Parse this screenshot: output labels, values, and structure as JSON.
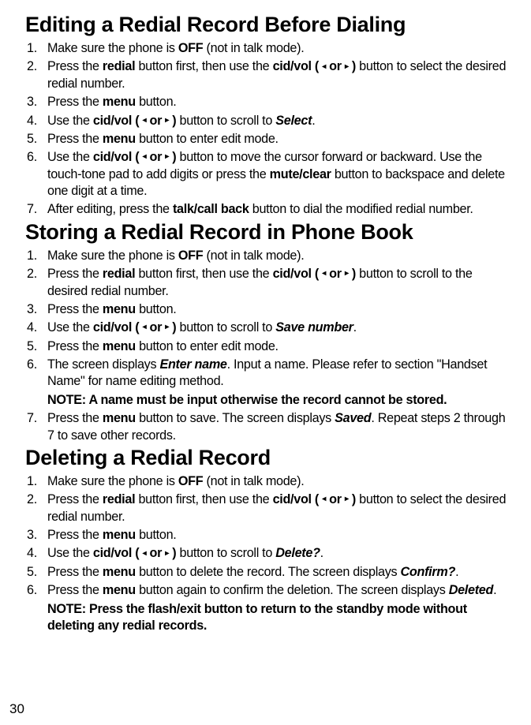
{
  "section1": {
    "heading": "Editing a Redial Record Before Dialing",
    "items": [
      {
        "n": "1.",
        "pre": "Make sure the phone is ",
        "b1": "OFF",
        "post1": " (not in talk mode)."
      },
      {
        "n": "2.",
        "pre": "Press the ",
        "b1": "redial",
        "mid1": " button first, then use the ",
        "b2": "cid/vol ( ",
        "arrows": true,
        "b3": " )",
        "post1": " button to select the desired redial number."
      },
      {
        "n": "3.",
        "pre": "Press the ",
        "b1": "menu",
        "post1": " button."
      },
      {
        "n": "4.",
        "pre": "Use the ",
        "b1": "cid/vol ( ",
        "arrows1": true,
        "b2": " )",
        "mid1": " button to scroll to ",
        "ib1": "Select",
        "post1": "."
      },
      {
        "n": "5.",
        "pre": "Press the ",
        "b1": "menu",
        "post1": " button to enter edit mode."
      },
      {
        "n": "6.",
        "pre": "Use the ",
        "b1": "cid/vol ( ",
        "arrows1": true,
        "b2": " )",
        "mid1": " button to move the cursor forward or backward. Use the touch-tone pad to add digits or press the ",
        "b3": "mute/clear",
        "post1": " button to backspace and delete one digit at a time."
      },
      {
        "n": "7.",
        "pre": "After editing, press the ",
        "b1": "talk/call back",
        "post1": " button to dial the modified redial number."
      }
    ]
  },
  "section2": {
    "heading": "Storing a Redial Record in Phone Book",
    "items": [
      {
        "n": "1.",
        "pre": "Make sure the phone is ",
        "b1": "OFF",
        "post1": " (not in talk mode)."
      },
      {
        "n": "2.",
        "pre": "Press the ",
        "b1": "redial",
        "mid1": " button first, then use the ",
        "b2": "cid/vol ( ",
        "arrows": true,
        "b3": " )",
        "post1": " button to scroll to the desired redial number."
      },
      {
        "n": "3.",
        "pre": "Press the ",
        "b1": "menu",
        "post1": " button."
      },
      {
        "n": "4.",
        "pre": "Use the ",
        "b1": "cid/vol ( ",
        "arrows1": true,
        "b2": " )",
        "mid1": " button to scroll to ",
        "ib1": "Save number",
        "post1": "."
      },
      {
        "n": "5.",
        "pre": "Press the ",
        "b1": "menu",
        "post1": " button to enter edit mode."
      },
      {
        "n": "6.",
        "pre": "The screen displays ",
        "ib1": "Enter name",
        "post1": ". Input a name. Please refer to section \"Handset Name\" for name editing method."
      },
      {
        "n": "7.",
        "pre": "Press the ",
        "b1": "menu",
        "mid1": " button to save. The screen displays ",
        "ib1": "Saved",
        "post1": ". Repeat steps 2 through 7 to save other records."
      }
    ],
    "note6": "NOTE: A name must be input otherwise the record cannot be stored."
  },
  "section3": {
    "heading": "Deleting a Redial Record",
    "items": [
      {
        "n": "1.",
        "pre": "Make sure the phone is ",
        "b1": "OFF",
        "post1": " (not in talk mode)."
      },
      {
        "n": "2.",
        "pre": "Press the ",
        "b1": "redial",
        "mid1": " button first, then use the ",
        "b2": "cid/vol ( ",
        "arrows": true,
        "b3": " )",
        "post1": " button to select the desired redial number."
      },
      {
        "n": "3.",
        "pre": "Press the ",
        "b1": "menu",
        "post1": " button."
      },
      {
        "n": "4.",
        "pre": "Use the ",
        "b1": "cid/vol ( ",
        "arrows1": true,
        "b2": " )",
        "mid1": " button to scroll to ",
        "ib1": "Delete?",
        "post1": "."
      },
      {
        "n": "5.",
        "pre": "Press the ",
        "b1": "menu",
        "mid1": " button to delete the record. The screen displays ",
        "ib1": "Confirm?",
        "post1": "."
      },
      {
        "n": "6.",
        "pre": "Press the ",
        "b1": "menu",
        "mid1": " button again to confirm the deletion. The screen displays ",
        "ib1": "Deleted",
        "post1": "."
      }
    ],
    "note6": "NOTE: Press the flash/exit button to return to the standby mode without deleting any redial records."
  },
  "pageNumber": "30",
  "arrowOr": " or "
}
